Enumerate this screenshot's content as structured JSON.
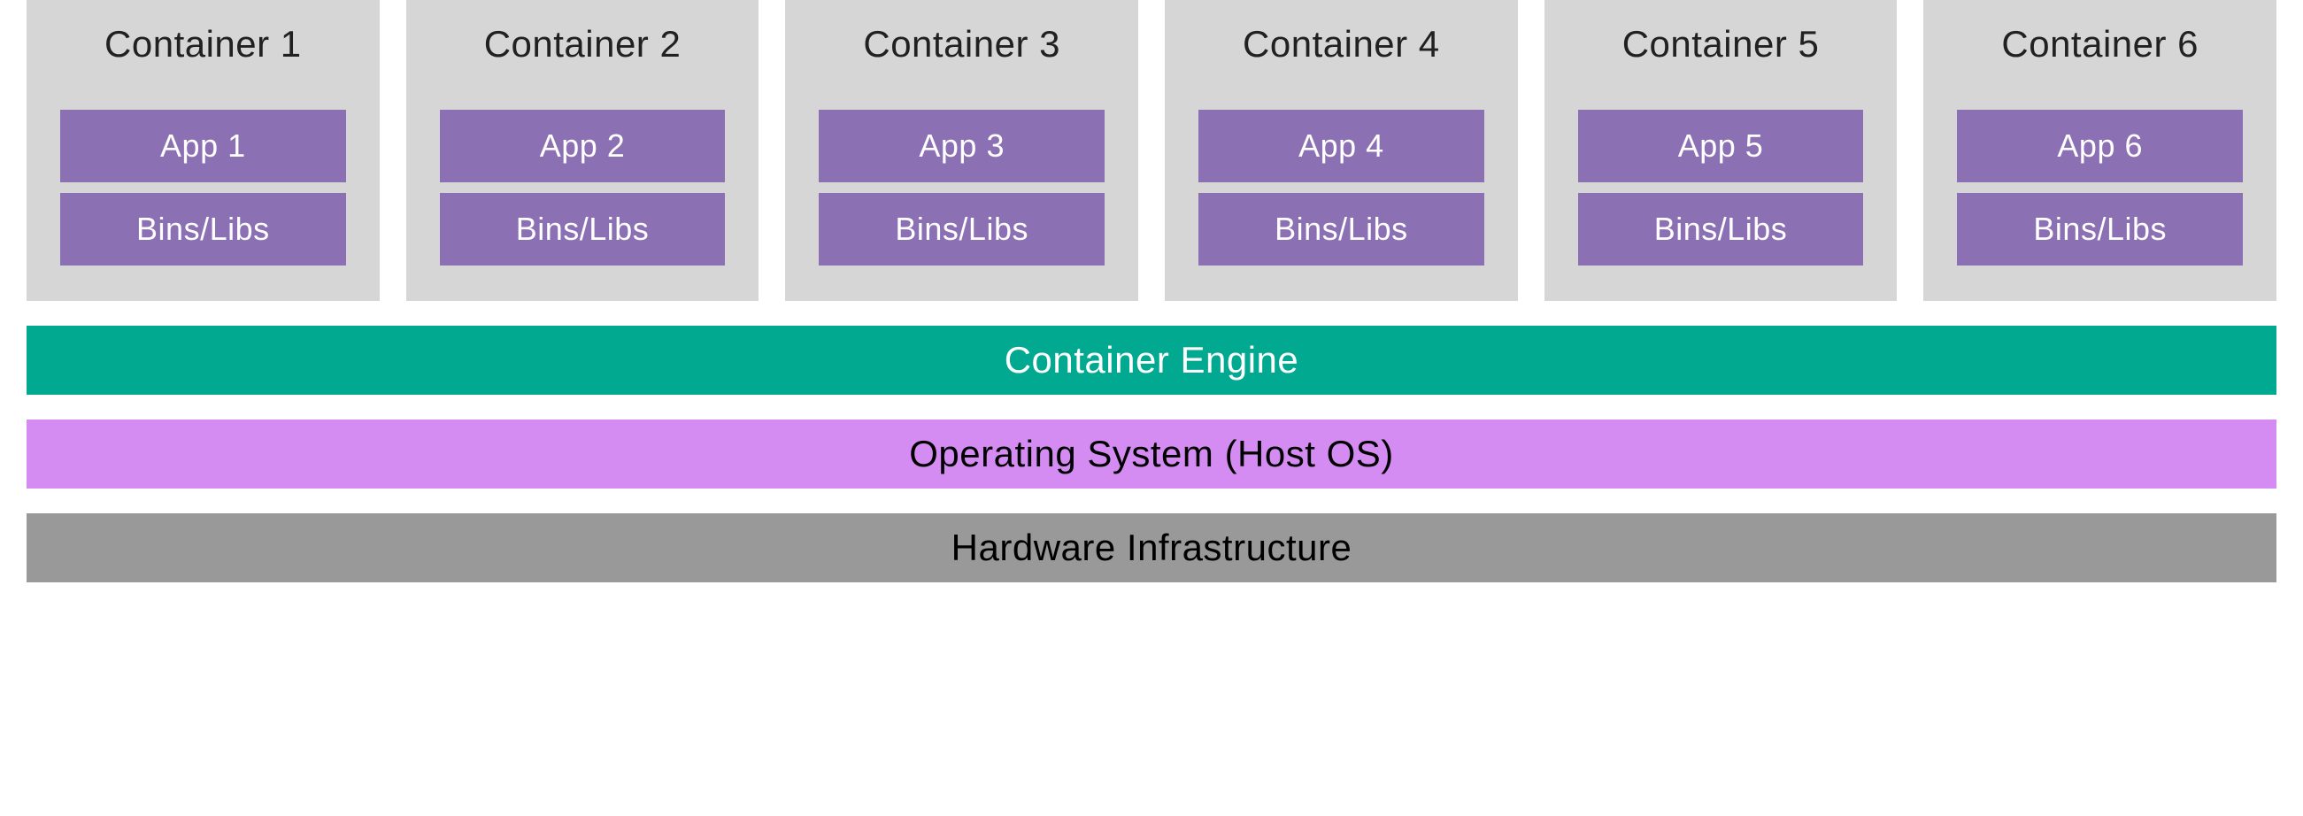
{
  "containers": [
    {
      "title": "Container 1",
      "app": "App 1",
      "bins": "Bins/Libs"
    },
    {
      "title": "Container 2",
      "app": "App 2",
      "bins": "Bins/Libs"
    },
    {
      "title": "Container 3",
      "app": "App 3",
      "bins": "Bins/Libs"
    },
    {
      "title": "Container 4",
      "app": "App 4",
      "bins": "Bins/Libs"
    },
    {
      "title": "Container 5",
      "app": "App 5",
      "bins": "Bins/Libs"
    },
    {
      "title": "Container 6",
      "app": "App 6",
      "bins": "Bins/Libs"
    }
  ],
  "layers": {
    "engine": "Container Engine",
    "os": "Operating System (Host OS)",
    "hardware": "Hardware Infrastructure"
  },
  "colors": {
    "container_bg": "#d6d6d6",
    "block_bg": "#8c70b4",
    "engine_bg": "#00a990",
    "os_bg": "#d58cf2",
    "hw_bg": "#999999"
  }
}
